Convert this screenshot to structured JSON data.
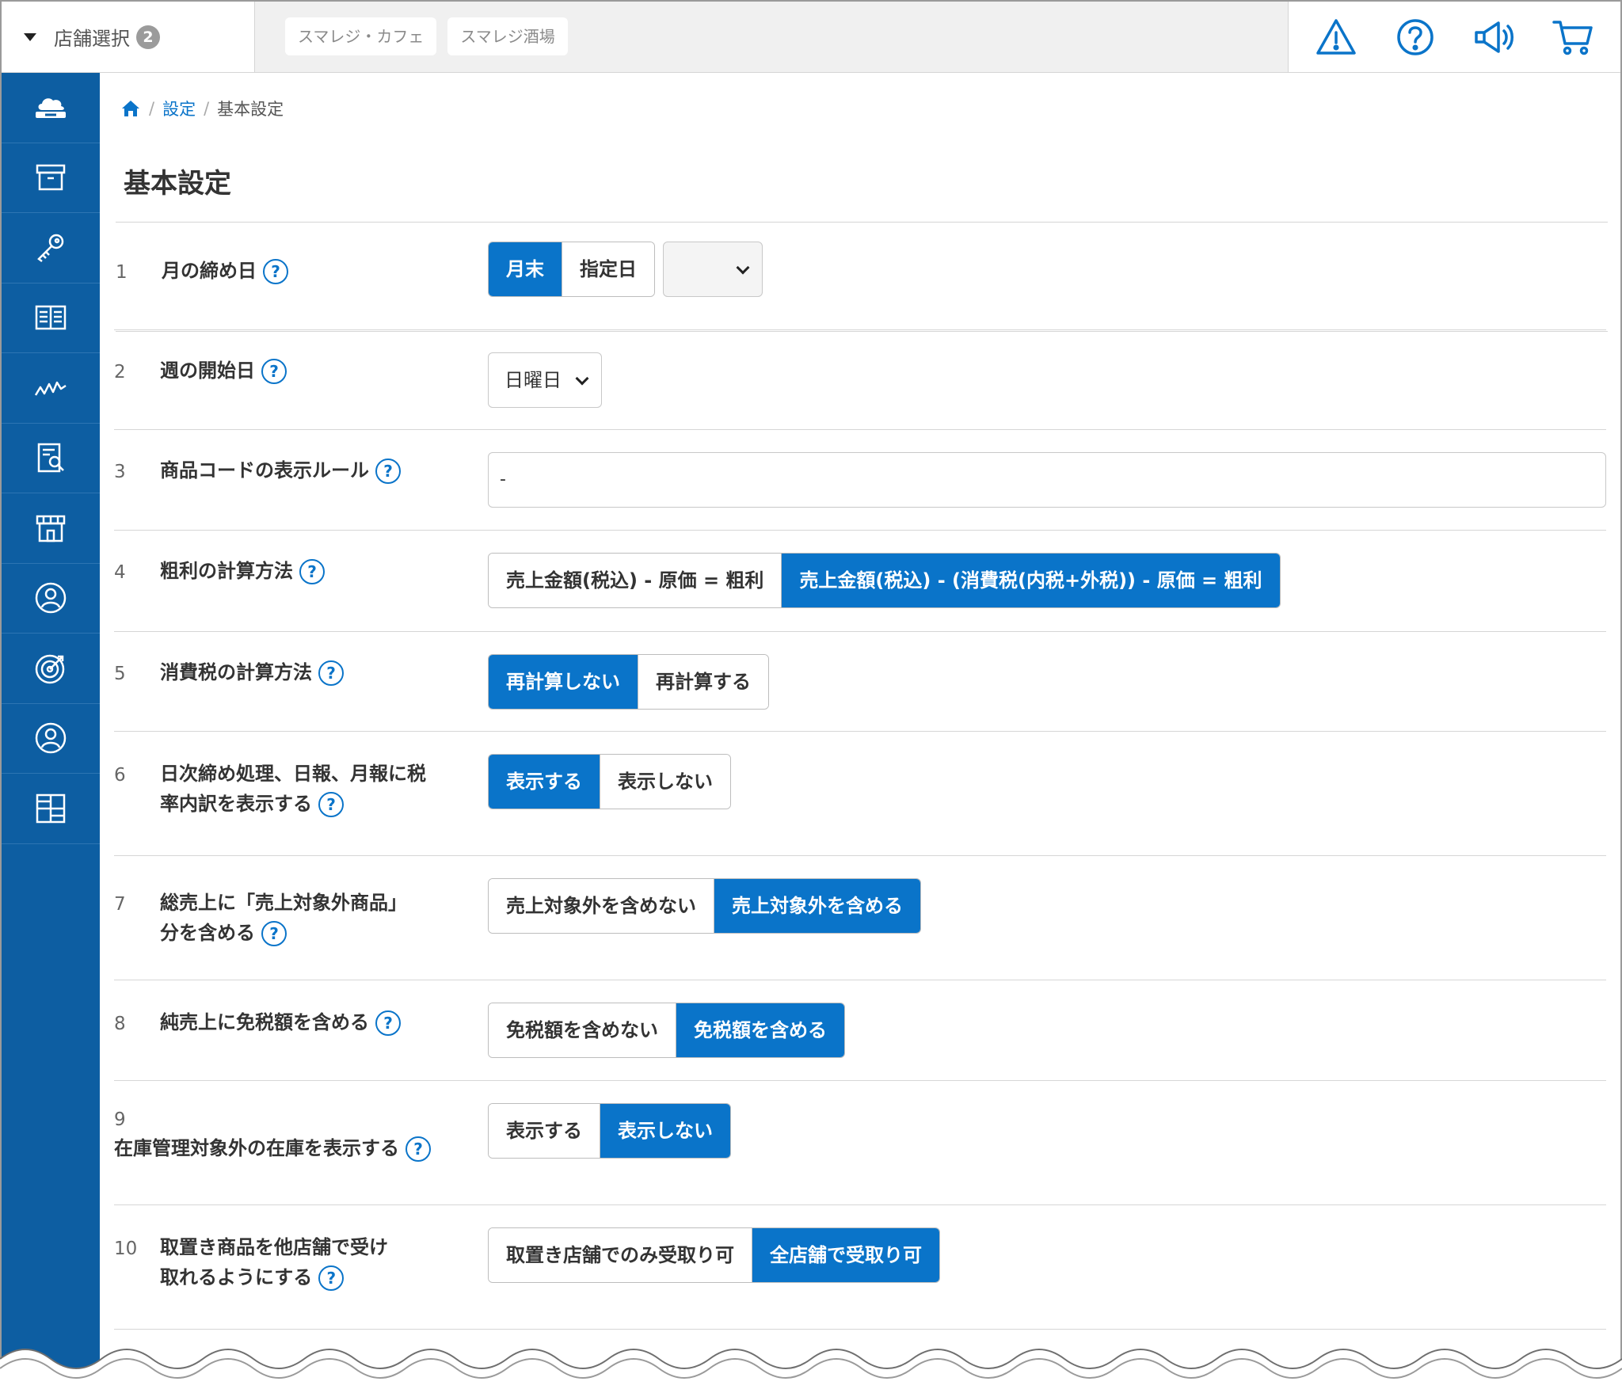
{
  "topbar": {
    "store_select_label": "店舗選択",
    "store_count": "2",
    "store_tabs": [
      "スマレジ・カフェ",
      "スマレジ酒場"
    ]
  },
  "icons": {
    "top": [
      "warning-icon",
      "help-icon",
      "megaphone-icon",
      "cart-icon"
    ],
    "sidebar": [
      "cloud-register-icon",
      "archive-box-icon",
      "key-icon",
      "book-icon",
      "chart-line-icon",
      "report-search-icon",
      "store-icon",
      "customer-icon",
      "target-icon",
      "user-icon",
      "apps-grid-icon"
    ]
  },
  "colors": {
    "accent": "#0a74c9",
    "sidebar": "#0d5ea2"
  },
  "breadcrumb": {
    "settings": "設定",
    "current": "基本設定"
  },
  "page_title": "基本設定",
  "help_mark": "?",
  "settings": [
    {
      "num": "1",
      "label": "月の締め日",
      "options": [
        "月末",
        "指定日"
      ],
      "selected": 0
    },
    {
      "num": "2",
      "label": "週の開始日",
      "select_value": "日曜日"
    },
    {
      "num": "3",
      "label": "商品コードの表示ルール",
      "value": "-"
    },
    {
      "num": "4",
      "label": "粗利の計算方法",
      "options": [
        "売上金額(税込) - 原価 = 粗利",
        "売上金額(税込) - (消費税(内税+外税)) - 原価 = 粗利"
      ],
      "selected": 1
    },
    {
      "num": "5",
      "label": "消費税の計算方法",
      "options": [
        "再計算しない",
        "再計算する"
      ],
      "selected": 0
    },
    {
      "num": "6",
      "label": "日次締め処理、日報、月報に税率内訳を表示する",
      "options": [
        "表示する",
        "表示しない"
      ],
      "selected": 0
    },
    {
      "num": "7",
      "label": "総売上に「売上対象外商品」分を含める",
      "options": [
        "売上対象外を含めない",
        "売上対象外を含める"
      ],
      "selected": 1
    },
    {
      "num": "8",
      "label": "純売上に免税額を含める",
      "options": [
        "免税額を含めない",
        "免税額を含める"
      ],
      "selected": 1
    },
    {
      "num": "9",
      "label": "在庫管理対象外の在庫を表示する",
      "options": [
        "表示する",
        "表示しない"
      ],
      "selected": 1
    },
    {
      "num": "10",
      "label": "取置き商品を他店舗で受け取れるようにする",
      "options": [
        "取置き店舗でのみ受取り可",
        "全店舗で受取り可"
      ],
      "selected": 1
    }
  ]
}
